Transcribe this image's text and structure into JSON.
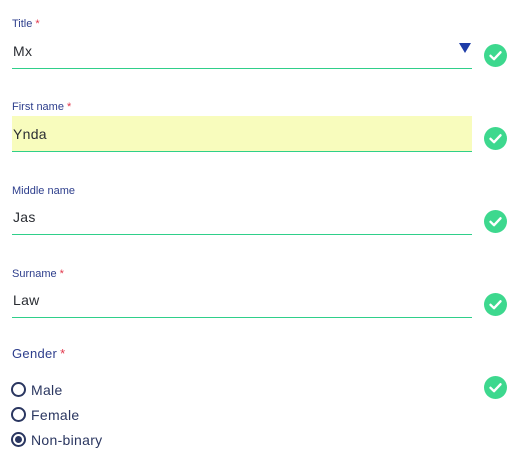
{
  "form": {
    "title_field": {
      "label": "Title",
      "required_mark": "*",
      "value": "Mx",
      "valid": true
    },
    "first_name_field": {
      "label": "First name",
      "required_mark": "*",
      "value": "Ynda",
      "valid": true
    },
    "middle_name_field": {
      "label": "Middle name",
      "value": "Jas",
      "valid": true
    },
    "surname_field": {
      "label": "Surname",
      "required_mark": "*",
      "value": "Law",
      "valid": true
    },
    "gender_field": {
      "label": "Gender",
      "required_mark": "*",
      "valid": true,
      "options": [
        {
          "label": "Male",
          "selected": false
        },
        {
          "label": "Female",
          "selected": false
        },
        {
          "label": "Non-binary",
          "selected": true
        }
      ]
    }
  },
  "colors": {
    "label": "#2d3e8c",
    "required": "#e2364a",
    "underline": "#2fcf8a",
    "check_badge": "#3dd88e",
    "highlight": "#f8fcbd",
    "dropdown_caret": "#1e3da8",
    "radio": "#2a3660"
  },
  "icons": {
    "dropdown": "caret-down-icon",
    "valid": "check-circle-icon",
    "radio_unselected": "radio-empty-icon",
    "radio_selected": "radio-filled-icon"
  }
}
